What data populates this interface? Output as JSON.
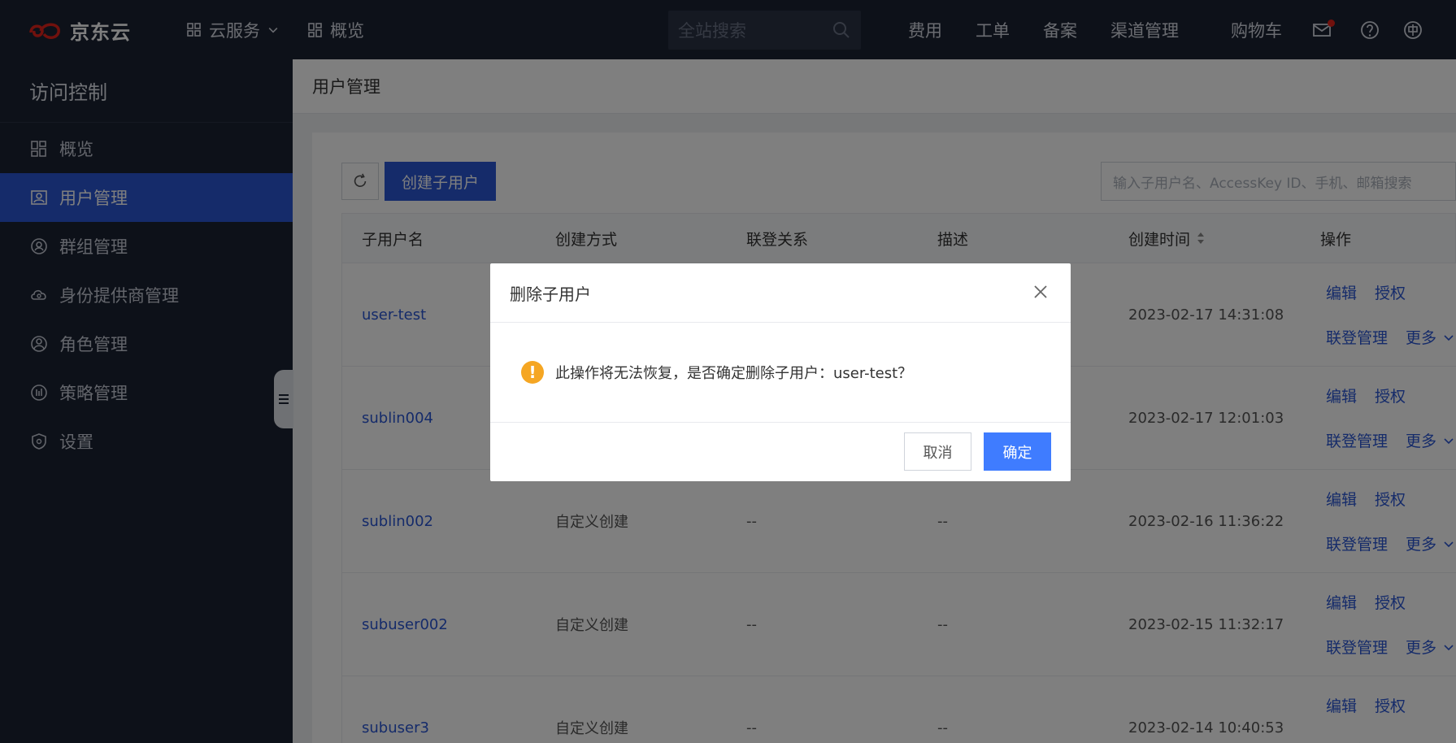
{
  "topbar": {
    "logo_text": "京东云",
    "cloud_services": "云服务",
    "overview": "概览",
    "search_placeholder": "全站搜索",
    "links": [
      "费用",
      "工单",
      "备案",
      "渠道管理",
      "购物车"
    ]
  },
  "sidebar": {
    "title": "访问控制",
    "items": [
      {
        "label": "概览",
        "icon": "dashboard-icon"
      },
      {
        "label": "用户管理",
        "icon": "user-card-icon"
      },
      {
        "label": "群组管理",
        "icon": "group-icon"
      },
      {
        "label": "身份提供商管理",
        "icon": "cloud-identity-icon"
      },
      {
        "label": "角色管理",
        "icon": "role-icon"
      },
      {
        "label": "策略管理",
        "icon": "policy-icon"
      },
      {
        "label": "设置",
        "icon": "shield-icon"
      }
    ]
  },
  "main": {
    "page_title": "用户管理",
    "create_button": "创建子用户",
    "search_placeholder": "输入子用户名、AccessKey ID、手机、邮箱搜索",
    "columns": [
      "子用户名",
      "创建方式",
      "联登关系",
      "描述",
      "创建时间",
      "操作"
    ],
    "rows": [
      {
        "name": "user-test",
        "method": "",
        "relation": "",
        "desc": "",
        "time": "2023-02-17 14:31:08"
      },
      {
        "name": "sublin004",
        "method": "",
        "relation": "",
        "desc": "",
        "time": "2023-02-17 12:01:03"
      },
      {
        "name": "sublin002",
        "method": "自定义创建",
        "relation": "--",
        "desc": "--",
        "time": "2023-02-16 11:36:22"
      },
      {
        "name": "subuser002",
        "method": "自定义创建",
        "relation": "--",
        "desc": "--",
        "time": "2023-02-15 11:32:17"
      },
      {
        "name": "subuser3",
        "method": "自定义创建",
        "relation": "--",
        "desc": "--",
        "time": "2023-02-14 10:40:53"
      }
    ],
    "ops": {
      "edit": "编辑",
      "authorize": "授权",
      "federation": "联登管理",
      "more": "更多"
    }
  },
  "modal": {
    "title": "删除子用户",
    "message": "此操作将无法恢复，是否确定删除子用户：user-test？",
    "cancel": "取消",
    "confirm": "确定"
  },
  "colors": {
    "topbar": "#1b2333",
    "accent": "#2a56d4",
    "confirm": "#3f7cff",
    "warning": "#f5a623"
  }
}
